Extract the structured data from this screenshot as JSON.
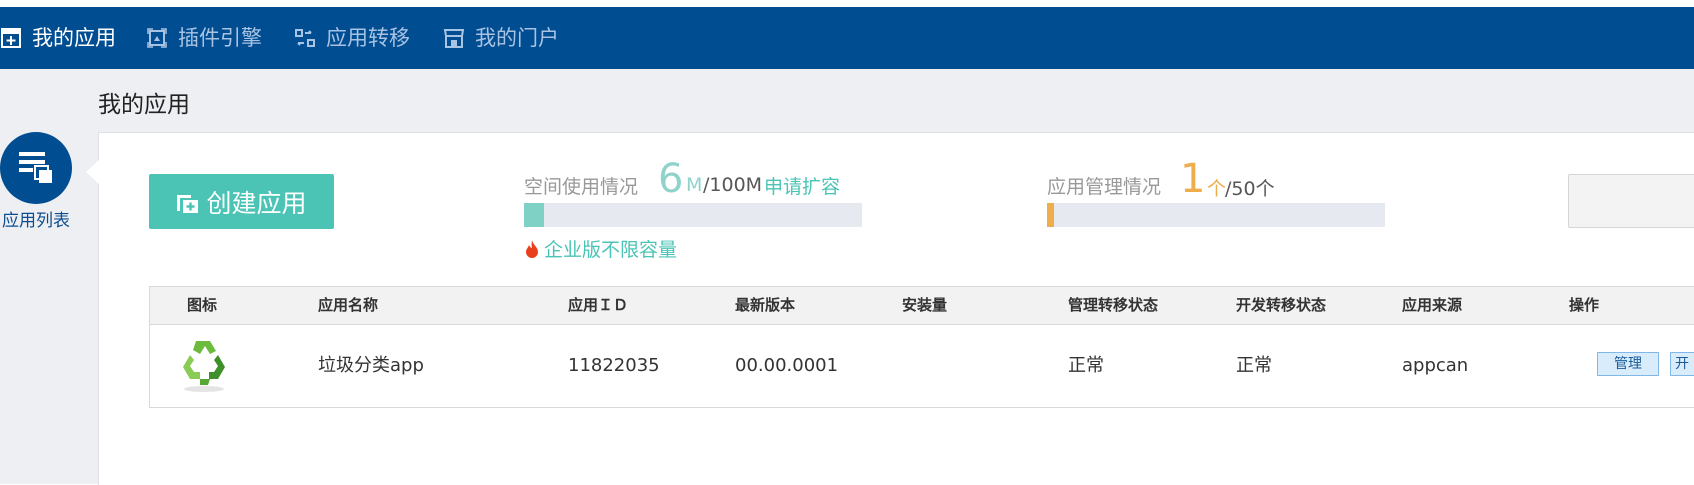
{
  "nav": {
    "items": [
      {
        "label": "我的应用",
        "icon": "app-plus-icon"
      },
      {
        "label": "插件引擎",
        "icon": "plugin-icon"
      },
      {
        "label": "应用转移",
        "icon": "transfer-icon"
      },
      {
        "label": "我的门户",
        "icon": "store-icon"
      }
    ]
  },
  "page": {
    "title": "我的应用"
  },
  "sidebar": {
    "label": "应用列表",
    "icon": "app-list-icon"
  },
  "create_button": {
    "label": "创建应用",
    "icon": "create-app-icon"
  },
  "space": {
    "label": "空间使用情况",
    "used": "6",
    "unit": "M",
    "total": "/100M",
    "expand_link": "申请扩容",
    "used_fraction": 0.06,
    "enterprise_note": "企业版不限容量"
  },
  "app_mgmt": {
    "label": "应用管理情况",
    "used": "1",
    "unit": "个",
    "total": "/50个",
    "used_fraction": 0.02
  },
  "table": {
    "headers": [
      "图标",
      "应用名称",
      "应用ＩＤ",
      "最新版本",
      "安装量",
      "管理转移状态",
      "开发转移状态",
      "应用来源",
      "操作"
    ],
    "rows": [
      {
        "icon": "recycle-icon",
        "name": "垃圾分类app",
        "id": "11822035",
        "version": "00.00.0001",
        "installs": "",
        "mgmt_status": "正常",
        "dev_status": "正常",
        "source": "appcan",
        "actions": [
          "管理",
          "开"
        ]
      }
    ]
  },
  "colors": {
    "nav_bg": "#004d92",
    "accent_teal": "#4bc4b5",
    "accent_orange": "#f0ad4e",
    "page_bg": "#edeff3"
  }
}
